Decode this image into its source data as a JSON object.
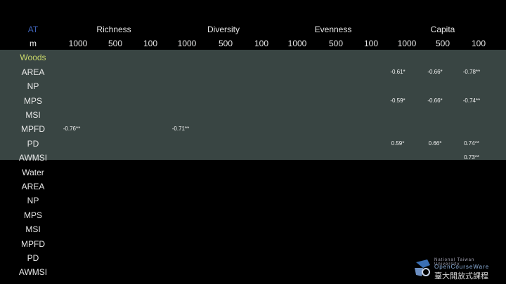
{
  "header": {
    "at": "AT",
    "m": "m",
    "groups": [
      "Richness",
      "Diversity",
      "Evenness",
      "Capita"
    ],
    "scales": [
      "1000",
      "500",
      "100"
    ]
  },
  "sections": {
    "woods": {
      "title": "Woods",
      "rows": [
        "AREA",
        "NP",
        "MPS",
        "MSI",
        "MPFD",
        "PD",
        "AWMSI"
      ]
    },
    "water": {
      "title": "Water",
      "rows": [
        "AREA",
        "NP",
        "MPS",
        "MSI",
        "MPFD",
        "PD",
        "AWMSI"
      ]
    }
  },
  "values": {
    "area_c1000": "-0.61*",
    "area_c500": "-0.66*",
    "area_c100": "-0.78**",
    "mps_c1000": "-0.59*",
    "mps_c500": "-0.66*",
    "mps_c100": "-0.74**",
    "mpfd_r1000": "-0.76**",
    "mpfd_d1000": "-0.71**",
    "pd_c1000": "0.59*",
    "pd_c500": "0.66*",
    "pd_c100": "0.74**",
    "awmsi_c100": "0.73**"
  },
  "logo": {
    "university": "National Taiwan University",
    "program": "OpenCourseWare",
    "chinese": "臺大開放式課程"
  },
  "colors": {
    "band": "#394543",
    "accent_section": "#c9d86a",
    "accent_at": "#3f63b8"
  }
}
